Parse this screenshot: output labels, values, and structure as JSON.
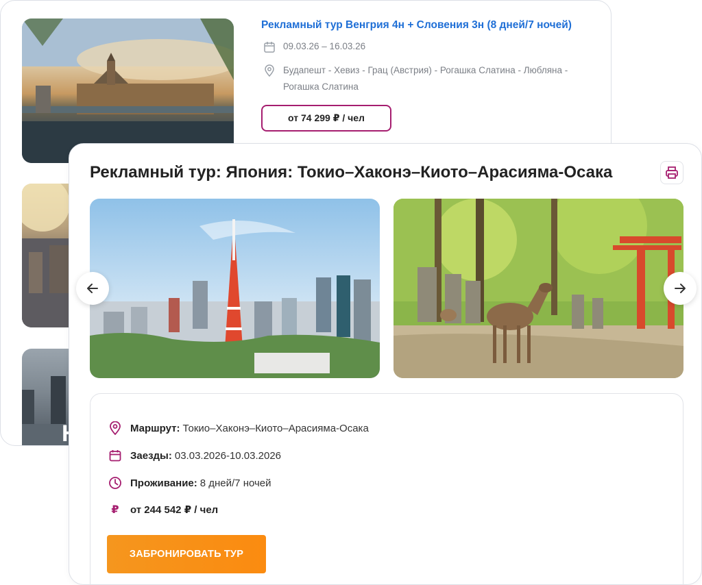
{
  "back_tour": {
    "title": "Рекламный тур Венгрия 4н + Словения 3н (8 дней/7 ночей)",
    "dates": "09.03.26 – 16.03.26",
    "route": "Будапешт - Хевиз - Грац (Австрия) - Рогашка Слатина - Любляна - Рогашка Слатина",
    "price": "от 74 299 ₽ / чел",
    "partial_thumb_text": "Н"
  },
  "modal": {
    "title": "Рекламный тур: Япония: Токио–Хаконэ–Киото–Арасияма-Осака",
    "icons": {
      "print": "printer-icon",
      "prev": "arrow-left-icon",
      "next": "arrow-right-icon"
    },
    "info": {
      "route_label": "Маршрут:",
      "route_value": "Токио–Хаконэ–Киото–Арасияма-Осака",
      "dates_label": "Заезды:",
      "dates_value": "03.03.2026-10.03.2026",
      "stay_label": "Проживание:",
      "stay_value": "8 дней/7 ночей",
      "price": "от 244 542 ₽ / чел",
      "ruble_symbol": "₽"
    },
    "book_button": "ЗАБРОНИРОВАТЬ ТУР"
  },
  "colors": {
    "accent": "#a51d6f",
    "link": "#1f6fd6",
    "button": "#f7931e"
  }
}
